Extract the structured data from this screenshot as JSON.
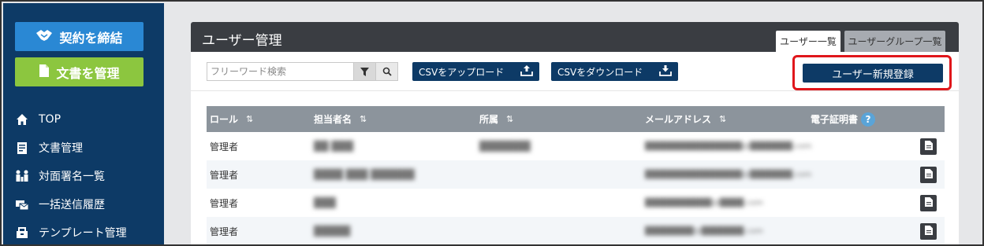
{
  "sidebar": {
    "btn_contract": "契約を締結",
    "btn_docs": "文書を管理",
    "nav": [
      {
        "label": "TOP",
        "icon": "home-icon"
      },
      {
        "label": "文書管理",
        "icon": "document-icon"
      },
      {
        "label": "対面署名一覧",
        "icon": "in-person-signing-icon"
      },
      {
        "label": "一括送信履歴",
        "icon": "bulk-send-icon"
      },
      {
        "label": "テンプレート管理",
        "icon": "template-icon"
      }
    ]
  },
  "panel": {
    "title": "ユーザー管理",
    "tabs": [
      {
        "label": "ユーザー一覧",
        "active": true
      },
      {
        "label": "ユーザーグループ一覧",
        "active": false
      }
    ]
  },
  "toolbar": {
    "search_placeholder": "フリーワード検索",
    "upload_csv": "CSVをアップロード",
    "download_csv": "CSVをダウンロード",
    "new_user": "ユーザー新規登録"
  },
  "table": {
    "headers": {
      "role": "ロール",
      "name": "担当者名",
      "dept": "所属",
      "email": "メールアドレス",
      "cert": "電子証明書"
    },
    "sort_glyph": "⇅",
    "help_glyph": "?",
    "rows": [
      {
        "role": "管理者",
        "name": "██ ███",
        "dept": "███████",
        "email": "████████████████@███████.com"
      },
      {
        "role": "管理者",
        "name": "████ ███ ██████",
        "dept": "",
        "email": "████████████████@███████.com"
      },
      {
        "role": "管理者",
        "name": "███",
        "dept": "",
        "email": "███████████@████.com"
      },
      {
        "role": "管理者",
        "name": "█████",
        "dept": "",
        "email": "████████@███████.com"
      }
    ]
  },
  "colors": {
    "sidebar_bg": "#0d3a66",
    "contract_btn": "#2a88d4",
    "docs_btn": "#8cc63f",
    "highlight_border": "#e0161b"
  }
}
